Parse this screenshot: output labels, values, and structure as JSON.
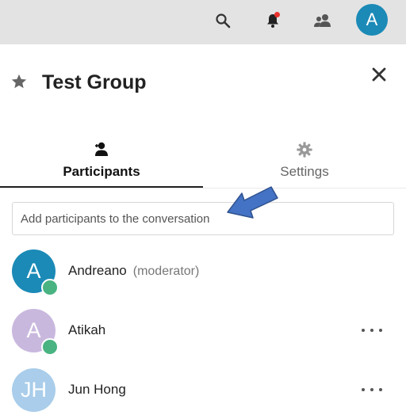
{
  "topbar": {
    "icons": [
      "search-icon",
      "notifications-icon",
      "contacts-icon"
    ],
    "avatar_initial": "A",
    "avatar_color": "#1b8ab7",
    "notification_dot_color": "#e9322d"
  },
  "conversation": {
    "title": "Test Group",
    "favorite_icon": "star-icon",
    "close_icon": "close-icon"
  },
  "tabs": [
    {
      "label": "Participants",
      "icon": "participants-icon",
      "active": true
    },
    {
      "label": "Settings",
      "icon": "gear-icon",
      "active": false
    }
  ],
  "search": {
    "placeholder": "Add participants to the conversation",
    "value": ""
  },
  "annotation": {
    "arrow_color": "#4472c4"
  },
  "participants": [
    {
      "initials": "A",
      "name": "Andreano",
      "role": "(moderator)",
      "avatar_color": "#1b8ab7",
      "online": true,
      "has_menu": false
    },
    {
      "initials": "A",
      "name": "Atikah",
      "role": "",
      "avatar_color": "#c9b8de",
      "online": true,
      "has_menu": true
    },
    {
      "initials": "JH",
      "name": "Jun Hong",
      "role": "",
      "avatar_color": "#a9cdea",
      "online": false,
      "has_menu": true
    }
  ]
}
